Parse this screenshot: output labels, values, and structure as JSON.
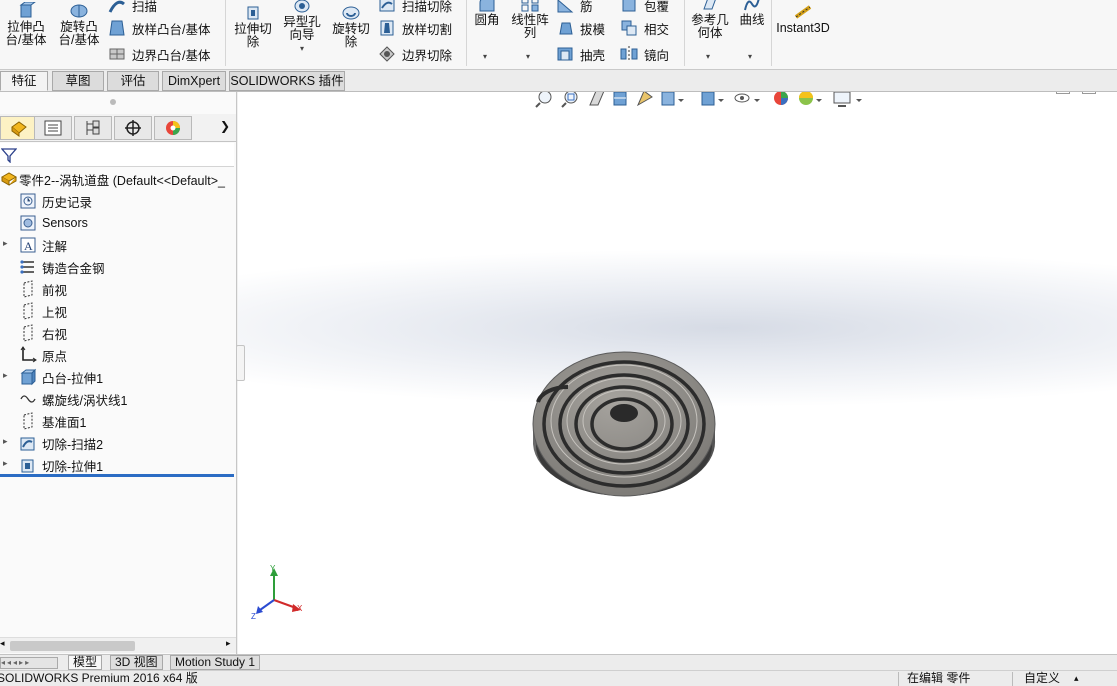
{
  "ribbon": {
    "extrude_boss": "拉伸凸\n台/基体",
    "revolve_boss": "旋转凸\n台/基体",
    "sweep": "扫描",
    "loft_boss": "放样凸台/基体",
    "boundary_boss": "边界凸台/基体",
    "extrude_cut": "拉伸切\n除",
    "hole_wizard": "异型孔\n向导",
    "revolve_cut": "旋转切\n除",
    "sweep_cut": "扫描切除",
    "loft_cut": "放样切割",
    "boundary_cut": "边界切除",
    "fillet": "圆角",
    "linear_pattern": "线性阵\n列",
    "rib": "筋",
    "draft": "拔模",
    "shell": "抽壳",
    "wrap": "包覆",
    "intersect": "相交",
    "mirror": "镜向",
    "ref_geometry": "参考几\n何体",
    "curves": "曲线",
    "instant3d": "Instant3D"
  },
  "cm_tabs": [
    "特征",
    "草图",
    "评估",
    "DimXpert",
    "SOLIDWORKS 插件"
  ],
  "tree": {
    "root": "零件2--涡轨道盘  (Default<<Default>_",
    "items": [
      "历史记录",
      "Sensors",
      "注解",
      "铸造合金钢",
      "前视",
      "上视",
      "右视",
      "原点",
      "凸台-拉伸1",
      "螺旋线/涡状线1",
      "基准面1",
      "切除-扫描2",
      "切除-拉伸1"
    ]
  },
  "bottom_tabs": [
    "模型",
    "3D 视图",
    "Motion Study 1"
  ],
  "status": {
    "product": "SOLIDWORKS Premium 2016 x64 版",
    "editing": "在编辑 零件",
    "units": "自定义"
  },
  "triad": {
    "x": "X",
    "y": "Y",
    "z": "Z"
  }
}
